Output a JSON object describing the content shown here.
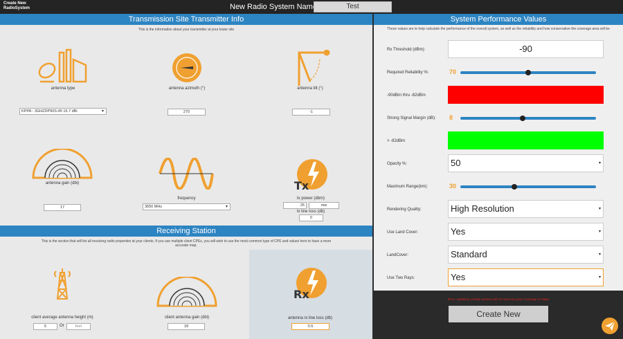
{
  "topbar": {
    "brand_line1": "Create New",
    "brand_line2": "RadioSystem",
    "sysname_label": "New Radio System Name:",
    "sysname_value": "Test"
  },
  "transmitter": {
    "title": "Transmission Site Transmitter Info",
    "desc": "This is the information about your transmitter at your tower site",
    "antenna_type_label": "antenna type",
    "antenna_type_value": "KPPA - 3GHZDP90S-45 16.7 dBi",
    "azimuth_label": "antenna azimuth (°)",
    "azimuth_value": "270",
    "tilt_label": "antenna tilt (°)",
    "tilt_value": "-1",
    "gain_label": "antenna gain (dbi)",
    "gain_value": "17",
    "frequency_label": "frequency",
    "frequency_value": "3650 MHz",
    "tx_power_label": "tx power (dbm)",
    "tx_power_value": "25",
    "tx_power_alt": "mw",
    "tx_loss_label": "tx line loss (db)",
    "tx_loss_value": "0"
  },
  "receiving": {
    "title": "Receiving Station",
    "desc_line1": "This is the section that will list all receiving radio properties at your clients. If you use multiple client CPEs, you will wish to use the most common type of CPE and values here to have a more",
    "desc_line2": "accurate map.",
    "height_label": "client average antenna height (m)",
    "height_value": "5",
    "height_or": "Or",
    "height_alt": "feet",
    "client_gain_label": "client antenna gain (dbi)",
    "client_gain_value": "18",
    "rx_loss_label": "antenna rx line loss (db)",
    "rx_loss_value": "0.5"
  },
  "performance": {
    "title": "System Performance Values",
    "desc": "These values are to help calculate the performance of the overall system, as well as the reliability and how conservative the coverage area will be",
    "rx_threshold_label": "Rx Threshold (dBm):",
    "rx_threshold_value": "-90",
    "reliability_label": "Required Reliability %:",
    "reliability_value": "70",
    "reliability_fraction": 0.5,
    "range1_label": "-90dBm thru -82dBm",
    "range1_color": "#ff0000",
    "strong_margin_label": "Strong Signal Margin (dB):",
    "strong_margin_value": "8",
    "strong_margin_fraction": 0.46,
    "range2_label": "> -82dBm",
    "range2_color": "#00ff00",
    "opacity_label": "Opacity %:",
    "opacity_value": "50",
    "max_range_label": "Maximum Range(km):",
    "max_range_value": "30",
    "max_range_fraction": 0.4,
    "quality_label": "Rendering Quality:",
    "quality_value": "High Resolution",
    "land_cover_label": "Use Land Cover:",
    "land_cover_value": "Yes",
    "landcover_type_label": "LandCover:",
    "landcover_type_value": "Standard",
    "two_rays_label": "Use Two Rays:",
    "two_rays_value": "Yes"
  },
  "footer": {
    "error": "Error: Updating a Radio System will not save any prior Coverage or Maps",
    "create_label": "Create New",
    "send_icon": "paper-plane-icon"
  },
  "colors": {
    "accent": "#2d84c2",
    "orange": "#f0a030",
    "dark": "#242424"
  }
}
